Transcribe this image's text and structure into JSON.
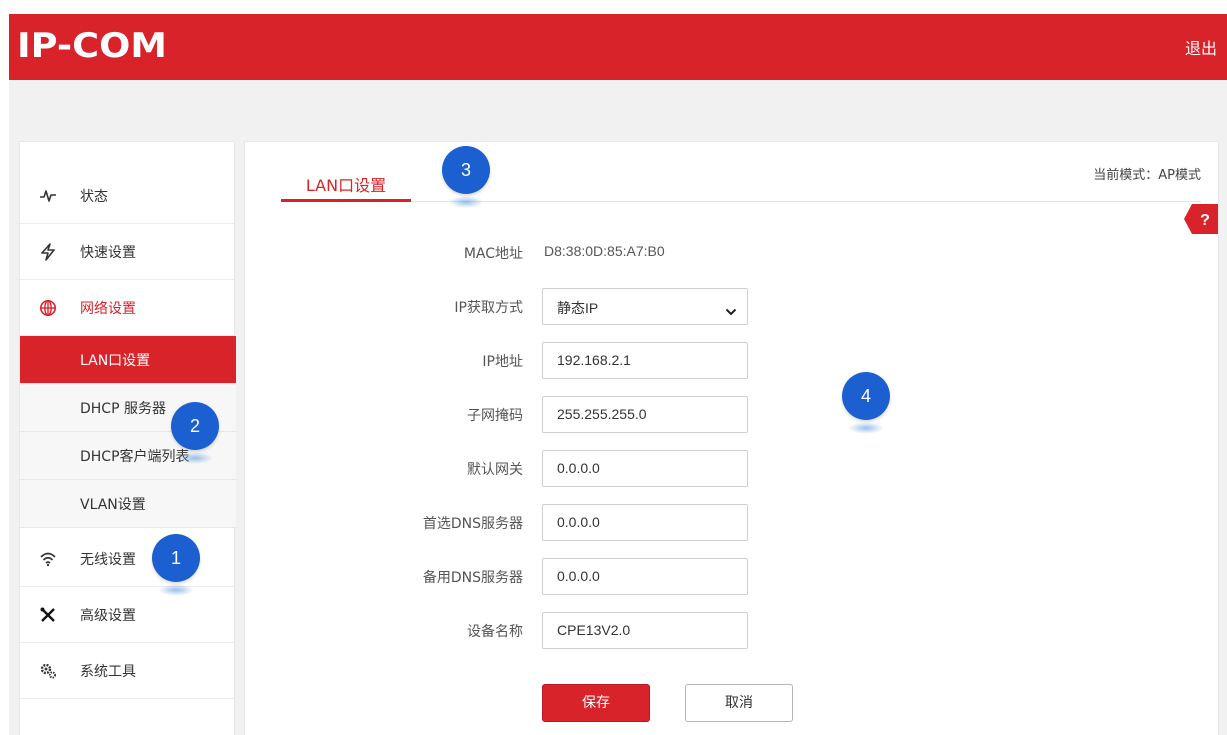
{
  "header": {
    "logo": "IP-COM",
    "logout_label": "退出"
  },
  "sidebar": {
    "items": [
      {
        "label": "状态",
        "icon": "activity-icon"
      },
      {
        "label": "快速设置",
        "icon": "lightning-icon"
      },
      {
        "label": "网络设置",
        "icon": "globe-icon"
      },
      {
        "label": "无线设置",
        "icon": "wifi-icon"
      },
      {
        "label": "高级设置",
        "icon": "tools-icon"
      },
      {
        "label": "系统工具",
        "icon": "gears-icon"
      }
    ],
    "subitems": [
      {
        "label": "LAN口设置"
      },
      {
        "label": "DHCP 服务器"
      },
      {
        "label": "DHCP客户端列表"
      },
      {
        "label": "VLAN设置"
      }
    ]
  },
  "main": {
    "tab_label": "LAN口设置",
    "mode_text": "当前模式：AP模式",
    "help_label": "?",
    "fields": {
      "mac_label": "MAC地址",
      "mac_value": "D8:38:0D:85:A7:B0",
      "ip_mode_label": "IP获取方式",
      "ip_mode_value": "静态IP",
      "ip_label": "IP地址",
      "ip_value": "192.168.2.1",
      "mask_label": "子网掩码",
      "mask_value": "255.255.255.0",
      "gateway_label": "默认网关",
      "gateway_value": "0.0.0.0",
      "dns1_label": "首选DNS服务器",
      "dns1_value": "0.0.0.0",
      "dns2_label": "备用DNS服务器",
      "dns2_value": "0.0.0.0",
      "device_label": "设备名称",
      "device_value": "CPE13V2.0"
    },
    "save_label": "保存",
    "cancel_label": "取消"
  },
  "callouts": {
    "c1": "1",
    "c2": "2",
    "c3": "3",
    "c4": "4"
  },
  "colors": {
    "brand_red": "#d9232b",
    "callout_blue": "#1b5fd1"
  }
}
